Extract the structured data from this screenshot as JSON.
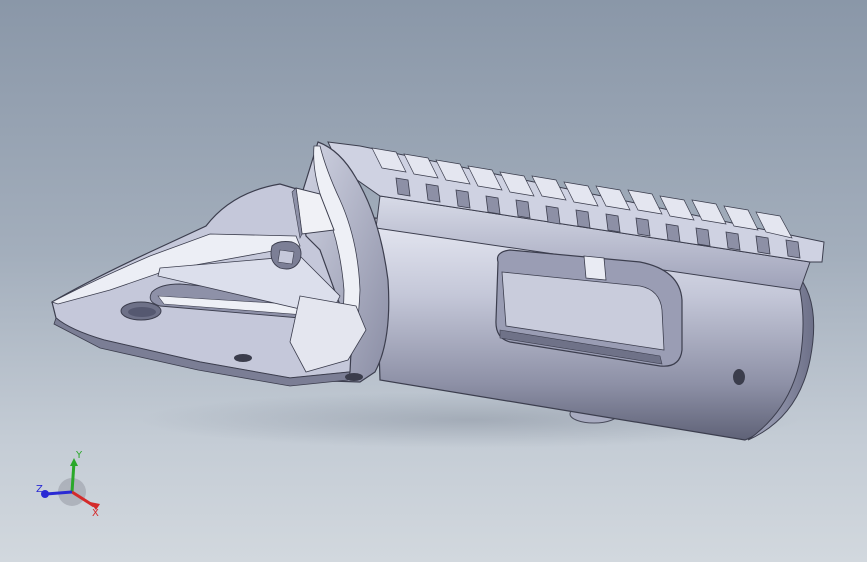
{
  "viewport": {
    "background_top": "#8a97a8",
    "background_bottom": "#d2d8de",
    "model_name": ""
  },
  "model": {
    "body_color": "#b8bccf",
    "shadow_color": "#6e7186",
    "highlight_color": "#e8eaf2"
  },
  "triad": {
    "x_label": "X",
    "y_label": "Y",
    "z_label": "Z",
    "x_color": "#d42a2a",
    "y_color": "#2aa82a",
    "z_color": "#2a2ad4"
  }
}
